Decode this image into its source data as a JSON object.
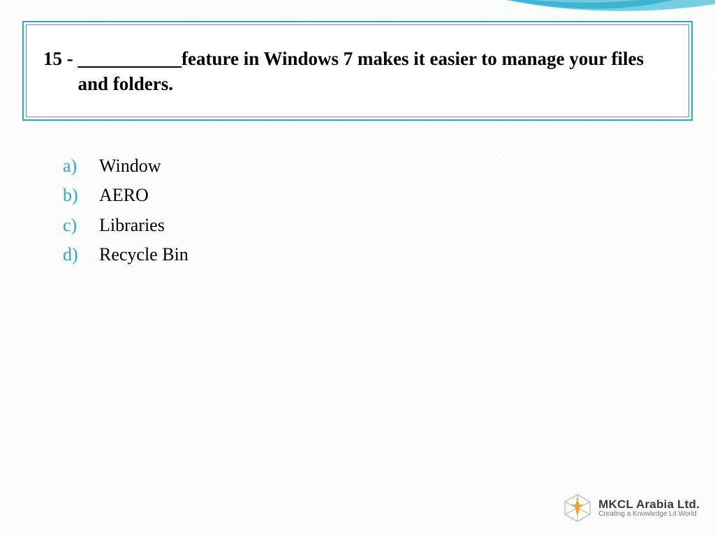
{
  "question": {
    "number": "15 - ",
    "text": "___________feature in Windows 7 makes it easier to manage your files and folders."
  },
  "options": [
    {
      "letter": "a)",
      "text": " Window"
    },
    {
      "letter": "b)",
      "text": "AERO"
    },
    {
      "letter": "c)",
      "text": "Libraries"
    },
    {
      "letter": "d)",
      "text": "Recycle Bin"
    }
  ],
  "branding": {
    "title": "MKCL Arabia Ltd.",
    "tagline": "Creating a Knowledge Lit World"
  },
  "colors": {
    "accent": "#2aa9c9"
  }
}
